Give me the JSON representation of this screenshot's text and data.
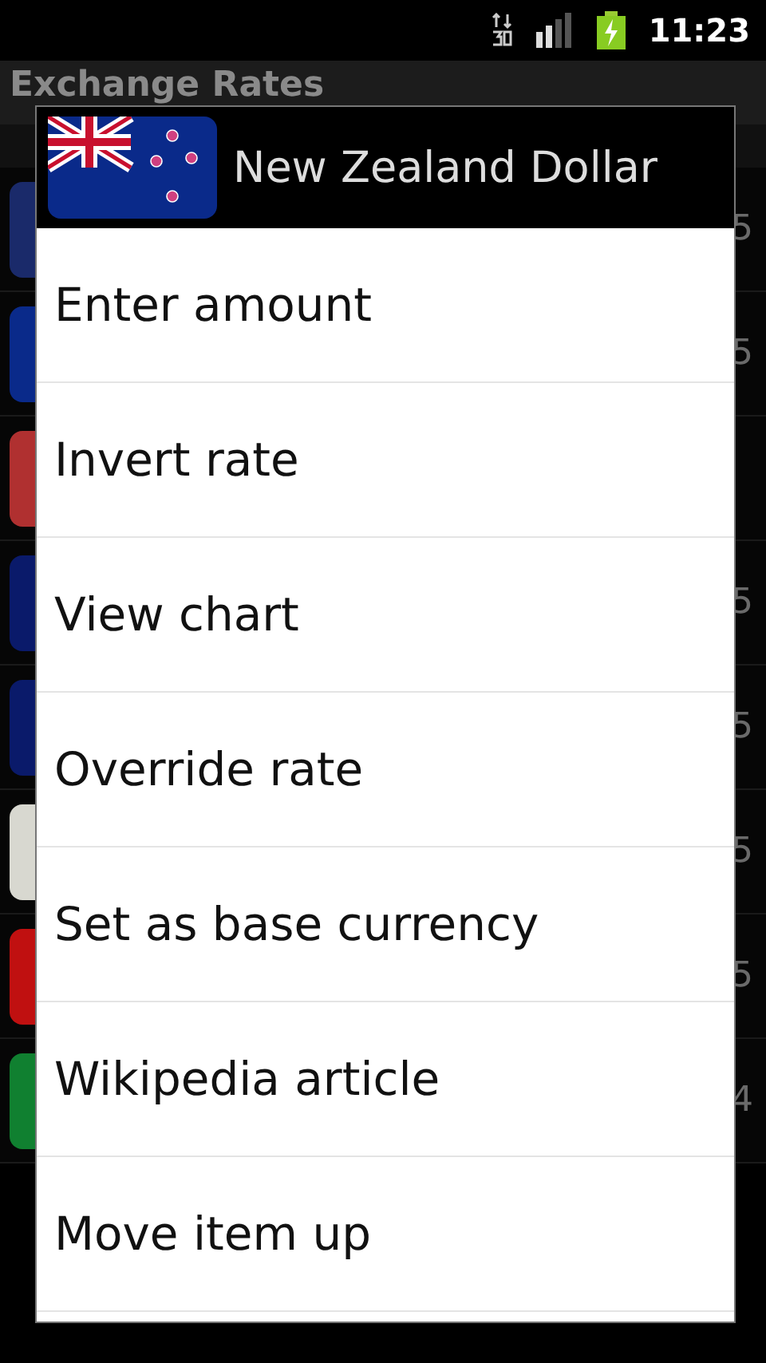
{
  "status_bar": {
    "time": "11:23"
  },
  "app": {
    "title": "Exchange Rates"
  },
  "rows": [
    {
      "color": "#1a2a6a",
      "value": "5"
    },
    {
      "color": "#0a2a8a",
      "value": "5"
    },
    {
      "color": "#b03030"
    },
    {
      "color": "#0a1a6a",
      "value": "5"
    },
    {
      "color": "#0a1a6a",
      "value": "5"
    },
    {
      "color": "#d8d8d0",
      "value": "5"
    },
    {
      "color": "#c01010",
      "value": "5"
    },
    {
      "color": "#108030",
      "value": "4"
    }
  ],
  "dialog": {
    "title": "New Zealand Dollar",
    "items": [
      "Enter amount",
      "Invert rate",
      "View chart",
      "Override rate",
      "Set as base currency",
      "Wikipedia article",
      "Move item up"
    ]
  }
}
